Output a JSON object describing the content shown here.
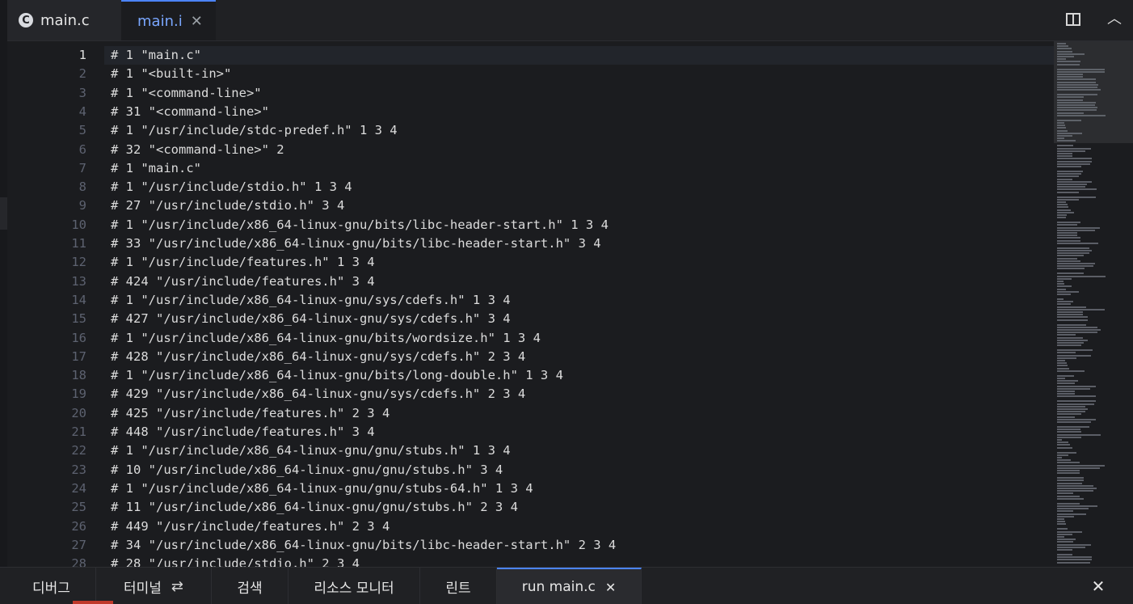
{
  "tabs": [
    {
      "label": "main.c",
      "icon": "c-language-icon",
      "active": false
    },
    {
      "label": "main.i",
      "active": true
    }
  ],
  "editor": {
    "active_line": 1,
    "lines": [
      {
        "n": "1",
        "text": "# 1 \"main.c\""
      },
      {
        "n": "2",
        "text": "# 1 \"<built-in>\""
      },
      {
        "n": "3",
        "text": "# 1 \"<command-line>\""
      },
      {
        "n": "4",
        "text": "# 31 \"<command-line>\""
      },
      {
        "n": "5",
        "text": "# 1 \"/usr/include/stdc-predef.h\" 1 3 4"
      },
      {
        "n": "6",
        "text": "# 32 \"<command-line>\" 2"
      },
      {
        "n": "7",
        "text": "# 1 \"main.c\""
      },
      {
        "n": "8",
        "text": "# 1 \"/usr/include/stdio.h\" 1 3 4"
      },
      {
        "n": "9",
        "text": "# 27 \"/usr/include/stdio.h\" 3 4"
      },
      {
        "n": "10",
        "text": "# 1 \"/usr/include/x86_64-linux-gnu/bits/libc-header-start.h\" 1 3 4"
      },
      {
        "n": "11",
        "text": "# 33 \"/usr/include/x86_64-linux-gnu/bits/libc-header-start.h\" 3 4"
      },
      {
        "n": "12",
        "text": "# 1 \"/usr/include/features.h\" 1 3 4"
      },
      {
        "n": "13",
        "text": "# 424 \"/usr/include/features.h\" 3 4"
      },
      {
        "n": "14",
        "text": "# 1 \"/usr/include/x86_64-linux-gnu/sys/cdefs.h\" 1 3 4"
      },
      {
        "n": "15",
        "text": "# 427 \"/usr/include/x86_64-linux-gnu/sys/cdefs.h\" 3 4"
      },
      {
        "n": "16",
        "text": "# 1 \"/usr/include/x86_64-linux-gnu/bits/wordsize.h\" 1 3 4"
      },
      {
        "n": "17",
        "text": "# 428 \"/usr/include/x86_64-linux-gnu/sys/cdefs.h\" 2 3 4"
      },
      {
        "n": "18",
        "text": "# 1 \"/usr/include/x86_64-linux-gnu/bits/long-double.h\" 1 3 4"
      },
      {
        "n": "19",
        "text": "# 429 \"/usr/include/x86_64-linux-gnu/sys/cdefs.h\" 2 3 4"
      },
      {
        "n": "20",
        "text": "# 425 \"/usr/include/features.h\" 2 3 4"
      },
      {
        "n": "21",
        "text": "# 448 \"/usr/include/features.h\" 3 4"
      },
      {
        "n": "22",
        "text": "# 1 \"/usr/include/x86_64-linux-gnu/gnu/stubs.h\" 1 3 4"
      },
      {
        "n": "23",
        "text": "# 10 \"/usr/include/x86_64-linux-gnu/gnu/stubs.h\" 3 4"
      },
      {
        "n": "24",
        "text": "# 1 \"/usr/include/x86_64-linux-gnu/gnu/stubs-64.h\" 1 3 4"
      },
      {
        "n": "25",
        "text": "# 11 \"/usr/include/x86_64-linux-gnu/gnu/stubs.h\" 2 3 4"
      },
      {
        "n": "26",
        "text": "# 449 \"/usr/include/features.h\" 2 3 4"
      },
      {
        "n": "27",
        "text": "# 34 \"/usr/include/x86_64-linux-gnu/bits/libc-header-start.h\" 2 3 4"
      },
      {
        "n": "28",
        "text": "# 28 \"/usr/include/stdio.h\" 2 3 4"
      }
    ]
  },
  "panel": {
    "tabs": [
      {
        "label": "디버그"
      },
      {
        "label": "터미널",
        "icon": "refresh-icon"
      },
      {
        "label": "검색"
      },
      {
        "label": "리소스 모니터"
      },
      {
        "label": "린트"
      },
      {
        "label": "run main.c",
        "active": true
      }
    ]
  },
  "colors": {
    "accent": "#4c84ff",
    "background": "#1b1c1f"
  }
}
